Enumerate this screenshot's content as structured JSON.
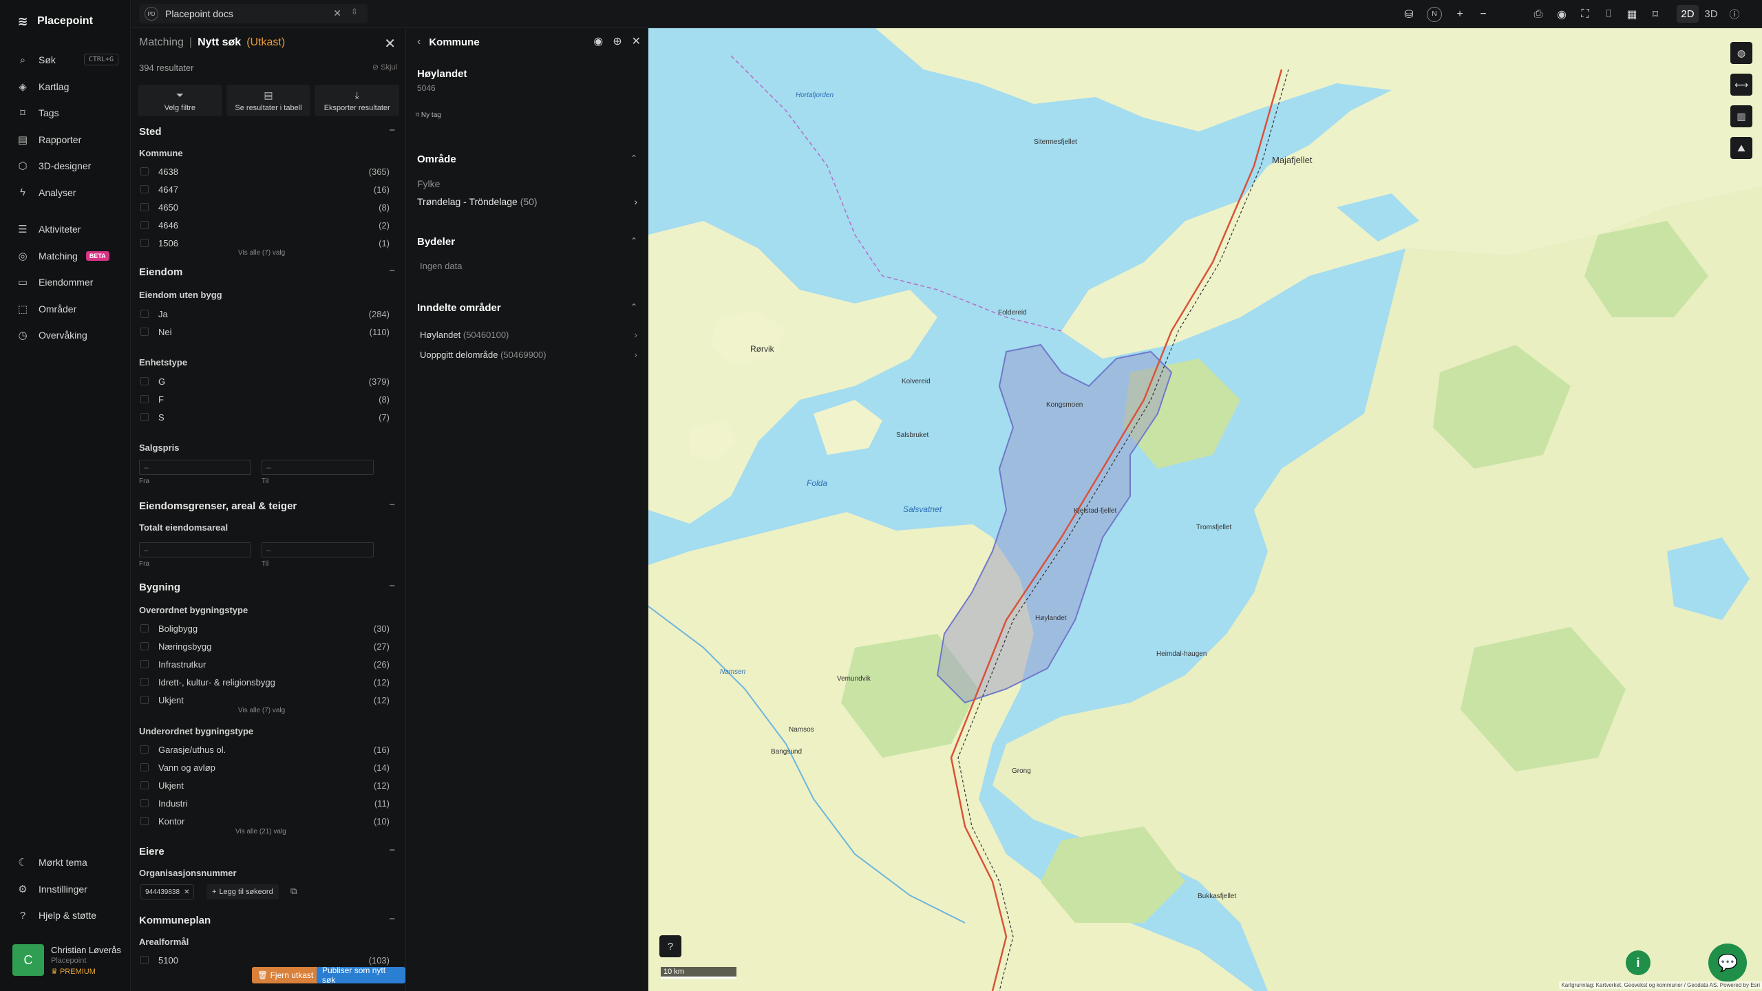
{
  "app": {
    "brand": "Placepoint"
  },
  "topbar": {
    "doc_tab": {
      "badge": "PD",
      "label": "Placepoint docs"
    },
    "modes": [
      "2D",
      "3D"
    ],
    "active_mode": "2D",
    "compass": "N"
  },
  "sidebar": {
    "items": [
      {
        "name": "search",
        "icon": "search-icon",
        "label": "Søk",
        "shortcut": "CTRL+G"
      },
      {
        "name": "layers",
        "icon": "layers-icon",
        "label": "Kartlag"
      },
      {
        "name": "tags",
        "icon": "bookmark-icon",
        "label": "Tags"
      },
      {
        "name": "reports",
        "icon": "chart-icon",
        "label": "Rapporter"
      },
      {
        "name": "3d-designer",
        "icon": "cube-icon",
        "label": "3D-designer"
      },
      {
        "name": "analyses",
        "icon": "bolt-icon",
        "label": "Analyser"
      }
    ],
    "items2": [
      {
        "name": "activities",
        "icon": "activity-icon",
        "label": "Aktiviteter"
      },
      {
        "name": "matching",
        "icon": "target-icon",
        "label": "Matching",
        "badge": "BETA"
      },
      {
        "name": "properties",
        "icon": "document-icon",
        "label": "Eiendommer"
      },
      {
        "name": "areas",
        "icon": "area-icon",
        "label": "Områder"
      },
      {
        "name": "monitoring",
        "icon": "monitor-icon",
        "label": "Overvåking"
      }
    ],
    "bottom": [
      {
        "name": "dark-theme",
        "icon": "moon-icon",
        "label": "Mørkt tema"
      },
      {
        "name": "settings",
        "icon": "gear-icon",
        "label": "Innstillinger"
      },
      {
        "name": "help",
        "icon": "help-icon",
        "label": "Hjelp & støtte"
      }
    ],
    "user": {
      "initial": "C",
      "name": "Christian Løverås",
      "org": "Placepoint",
      "plan": "PREMIUM"
    }
  },
  "matching": {
    "crumb": "Matching",
    "title": "Nytt søk",
    "status": "(Utkast)",
    "results": "394 resultater",
    "hide": "Skjul",
    "actions": [
      "Velg filtre",
      "Se resultater i tabell",
      "Eksporter resultater"
    ],
    "sted": {
      "title": "Sted",
      "kommune_label": "Kommune",
      "options": [
        {
          "label": "4638",
          "count": "(365)"
        },
        {
          "label": "4647",
          "count": "(16)"
        },
        {
          "label": "4650",
          "count": "(8)"
        },
        {
          "label": "4646",
          "count": "(2)"
        },
        {
          "label": "1506",
          "count": "(1)"
        }
      ],
      "more": "Vis alle (7) valg"
    },
    "eiendom": {
      "title": "Eiendom",
      "uten_bygg_label": "Eiendom uten bygg",
      "uten_bygg": [
        {
          "label": "Ja",
          "count": "(284)"
        },
        {
          "label": "Nei",
          "count": "(110)"
        }
      ],
      "enhetstype_label": "Enhetstype",
      "enhetstype": [
        {
          "label": "G",
          "count": "(379)"
        },
        {
          "label": "F",
          "count": "(8)"
        },
        {
          "label": "S",
          "count": "(7)"
        }
      ],
      "salgspris_label": "Salgspris",
      "from": "Fra",
      "to": "Til",
      "placeholder": "–"
    },
    "grenser": {
      "title": "Eiendomsgrenser, areal & teiger",
      "areal_label": "Totalt eiendomsareal"
    },
    "bygning": {
      "title": "Bygning",
      "over_label": "Overordnet bygningstype",
      "over": [
        {
          "label": "Boligbygg",
          "count": "(30)"
        },
        {
          "label": "Næringsbygg",
          "count": "(27)"
        },
        {
          "label": "Infrastrutkur",
          "count": "(26)"
        },
        {
          "label": "Idrett-, kultur- & religionsbygg",
          "count": "(12)"
        },
        {
          "label": "Ukjent",
          "count": "(12)"
        }
      ],
      "over_more": "Vis alle (7) valg",
      "under_label": "Underordnet bygningstype",
      "under": [
        {
          "label": "Garasje/uthus ol.",
          "count": "(16)"
        },
        {
          "label": "Vann og avløp",
          "count": "(14)"
        },
        {
          "label": "Ukjent",
          "count": "(12)"
        },
        {
          "label": "Industri",
          "count": "(11)"
        },
        {
          "label": "Kontor",
          "count": "(10)"
        }
      ],
      "under_more": "Vis alle (21) valg"
    },
    "eiere": {
      "title": "Eiere",
      "org_label": "Organisasjonsnummer",
      "chip": "944439838",
      "add_keyword": "Legg til søkeord"
    },
    "kommuneplan": {
      "title": "Kommuneplan",
      "areal_label": "Arealformål",
      "first_option": {
        "label": "5100",
        "count": "(103)"
      }
    },
    "remove_draft": "Fjern utkast",
    "publish": "Publiser som nytt søk"
  },
  "kommune": {
    "header": "Kommune",
    "name": "Høylandet",
    "code": "5046",
    "new_tag": "Ny tag",
    "omrade": {
      "title": "Område",
      "fylke_label": "Fylke",
      "fylke_value": "Trøndelag - Tröndelage",
      "fylke_count": "(50)"
    },
    "bydeler": {
      "title": "Bydeler",
      "empty": "Ingen data"
    },
    "inndelte": {
      "title": "Inndelte områder",
      "items": [
        {
          "label": "Høylandet",
          "code": "(50460100)"
        },
        {
          "label": "Uoppgitt delområde",
          "code": "(50469900)"
        }
      ]
    }
  },
  "map": {
    "scale": "10 km",
    "credit": "Kartgrunnlag: Kartverket, Geovekst og kommuner / Geodata AS. Powered by Esri",
    "labels": {
      "l1": "Hortafjorden",
      "l2": "Sitermesfjellet",
      "l3": "Majafjellet",
      "l4": "Rørvik",
      "l5": "Kolvereid",
      "l6": "Salsvatnet",
      "l7": "Kongsmoen",
      "l8": "Kjelstad-fjellet",
      "l9": "Høylandet",
      "l10": "Tromsfjellet",
      "l11": "Heimdal-haugen",
      "l12": "Namsos",
      "l13": "Bangsund",
      "l14": "Bukkasfjellet",
      "l15": "Grong",
      "l16": "Salsbruket",
      "l17": "Foldereid",
      "l18": "Vemundvik",
      "l19": "Folda",
      "l20": "Namsen"
    }
  },
  "colors": {
    "accent_orange": "#e89a3c",
    "publish_blue": "#2b7fd3",
    "beta_pink": "#d63384",
    "avatar_green": "#2f9e52"
  }
}
